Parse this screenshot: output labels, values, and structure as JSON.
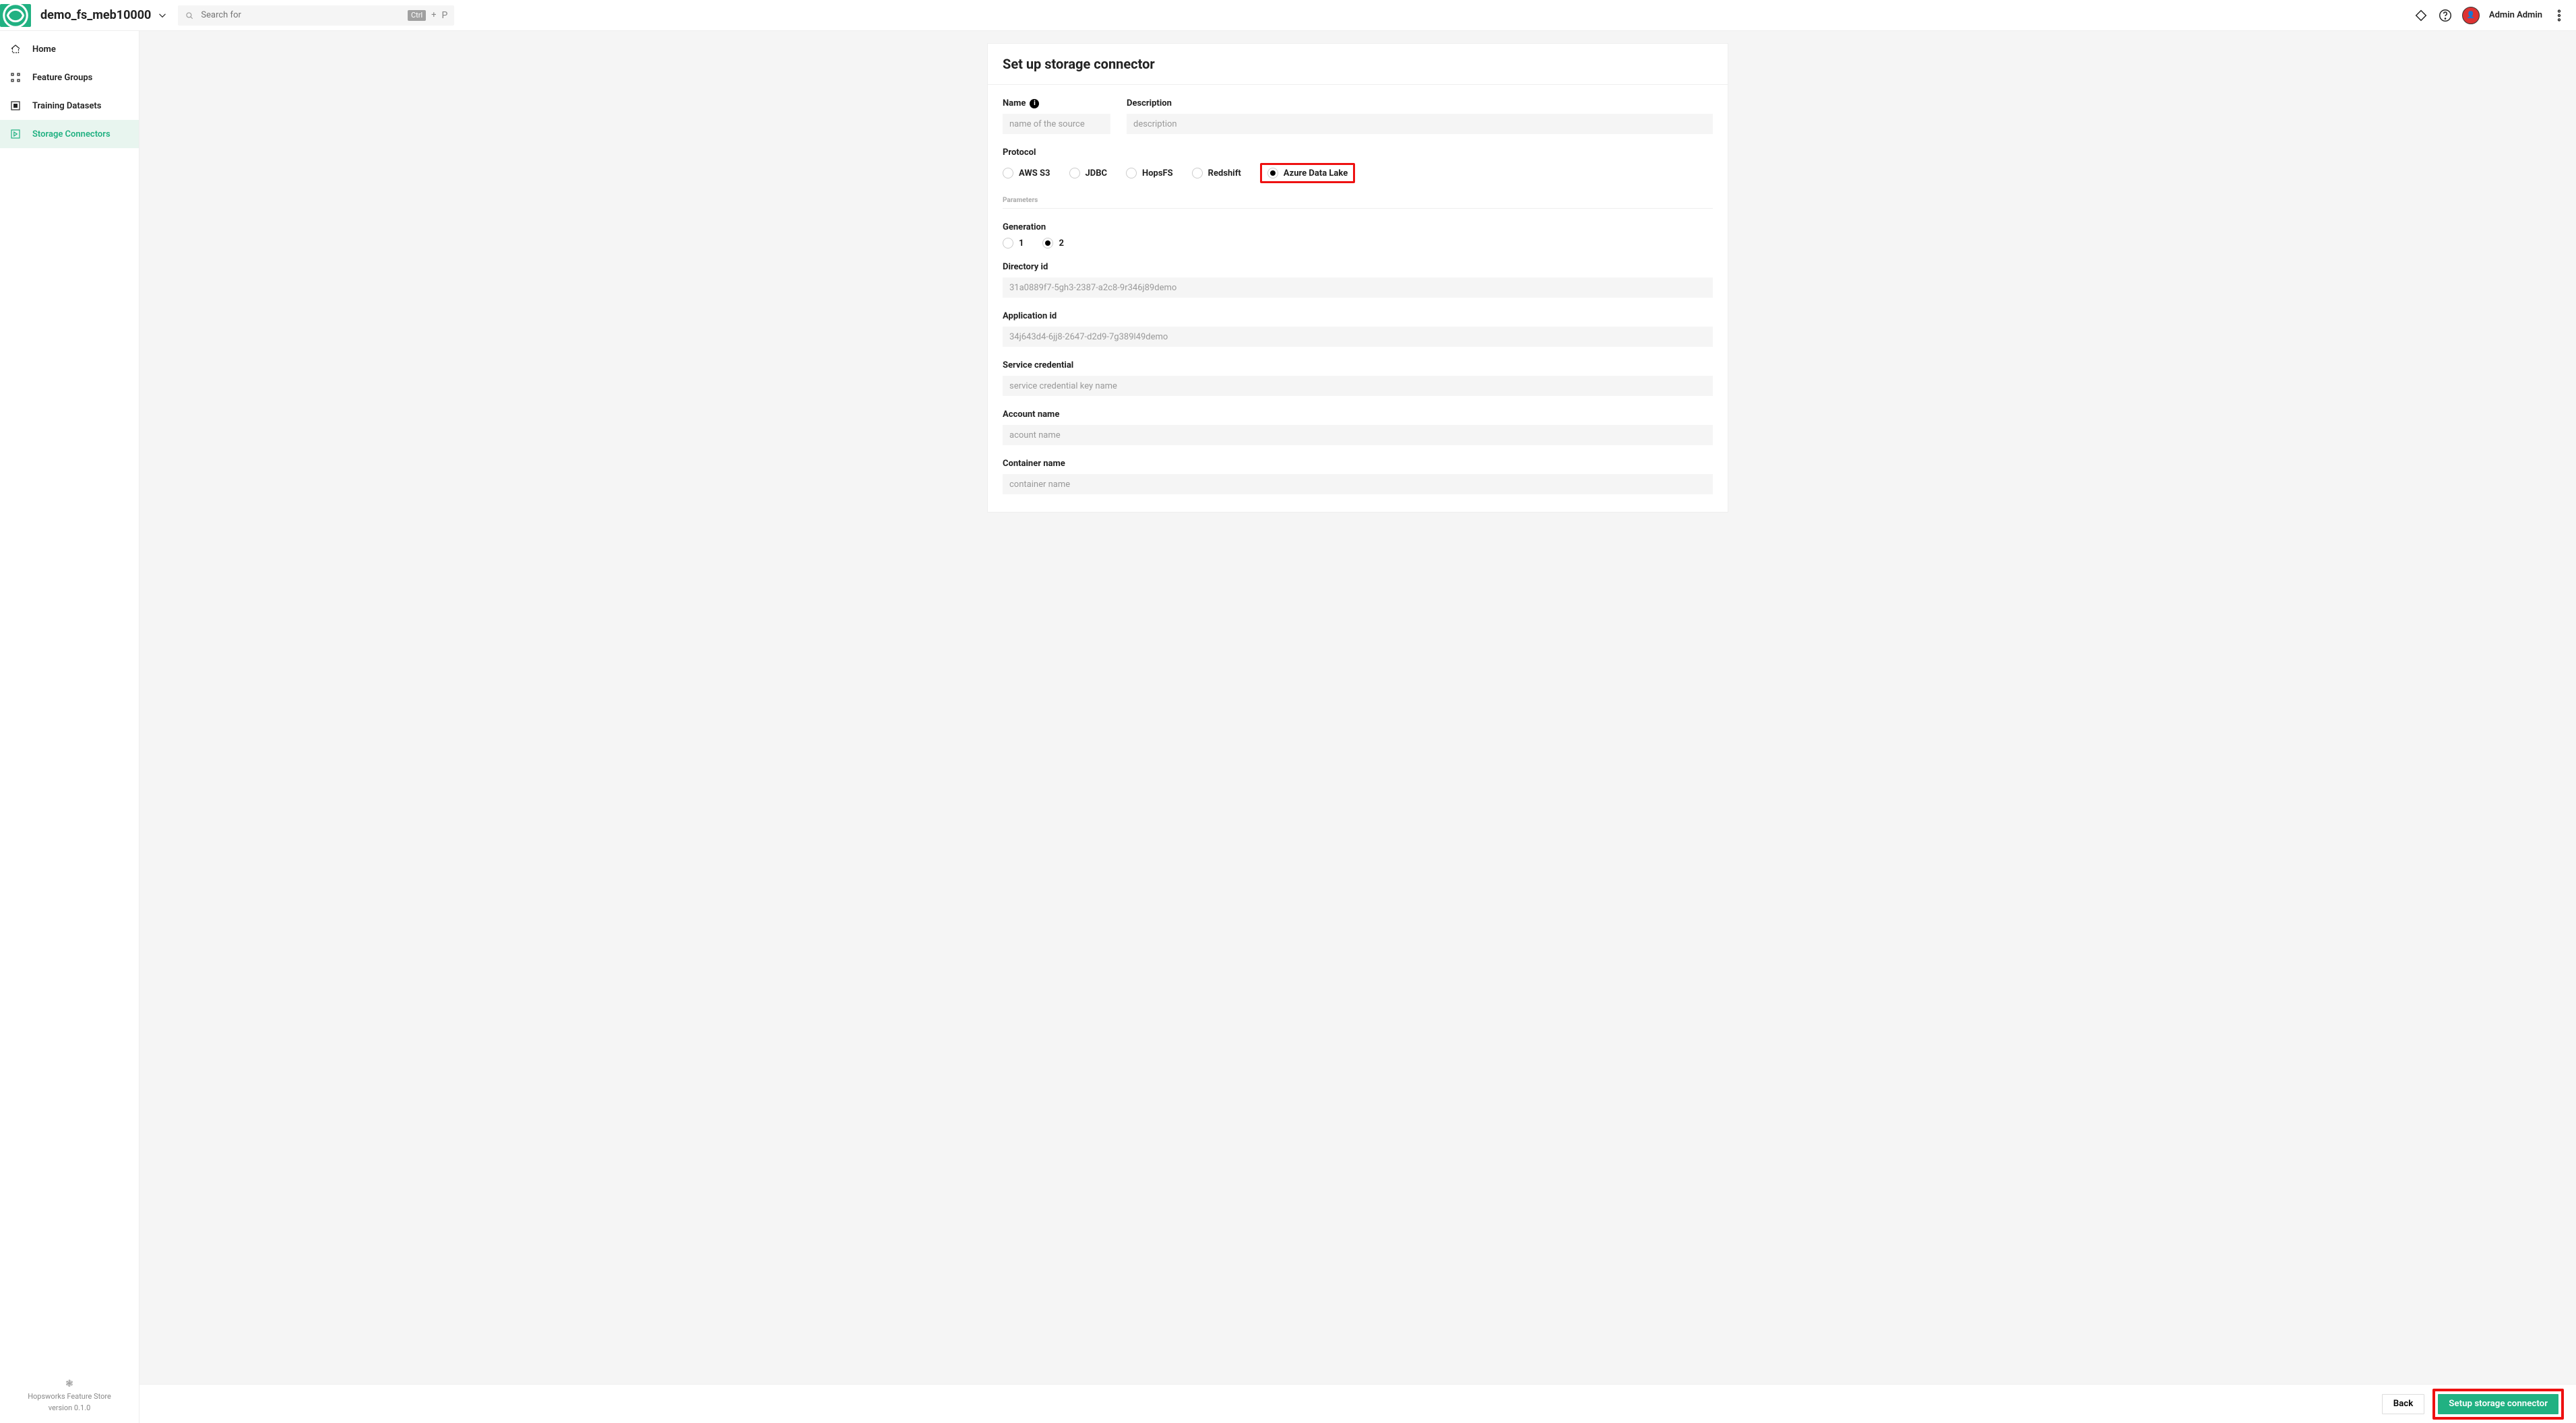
{
  "header": {
    "project_name": "demo_fs_meb10000",
    "search_placeholder": "Search for",
    "kbd_label": "Ctrl",
    "kbd_plus": "+",
    "kbd_key": "P",
    "user_name": "Admin Admin"
  },
  "sidebar": {
    "items": [
      {
        "label": "Home"
      },
      {
        "label": "Feature Groups"
      },
      {
        "label": "Training Datasets"
      },
      {
        "label": "Storage Connectors"
      }
    ],
    "footer_line1": "Hopsworks Feature Store",
    "footer_line2": "version 0.1.0"
  },
  "card": {
    "title": "Set up storage connector",
    "name_label": "Name",
    "name_placeholder": "name of the source",
    "description_label": "Description",
    "description_placeholder": "description",
    "protocol_label": "Protocol",
    "protocols": [
      "AWS S3",
      "JDBC",
      "HopsFS",
      "Redshift",
      "Azure Data Lake"
    ],
    "protocol_selected": "Azure Data Lake",
    "parameters_label": "Parameters",
    "generation_label": "Generation",
    "generation_options": [
      "1",
      "2"
    ],
    "generation_selected": "2",
    "fields": [
      {
        "label": "Directory id",
        "placeholder": "31a0889f7-5gh3-2387-a2c8-9r346j89demo"
      },
      {
        "label": "Application id",
        "placeholder": "34j643d4-6jj8-2647-d2d9-7g389l49demo"
      },
      {
        "label": "Service credential",
        "placeholder": "service credential key name"
      },
      {
        "label": "Account name",
        "placeholder": "acount name"
      },
      {
        "label": "Container name",
        "placeholder": "container name"
      }
    ]
  },
  "footer": {
    "back": "Back",
    "submit": "Setup storage connector"
  }
}
